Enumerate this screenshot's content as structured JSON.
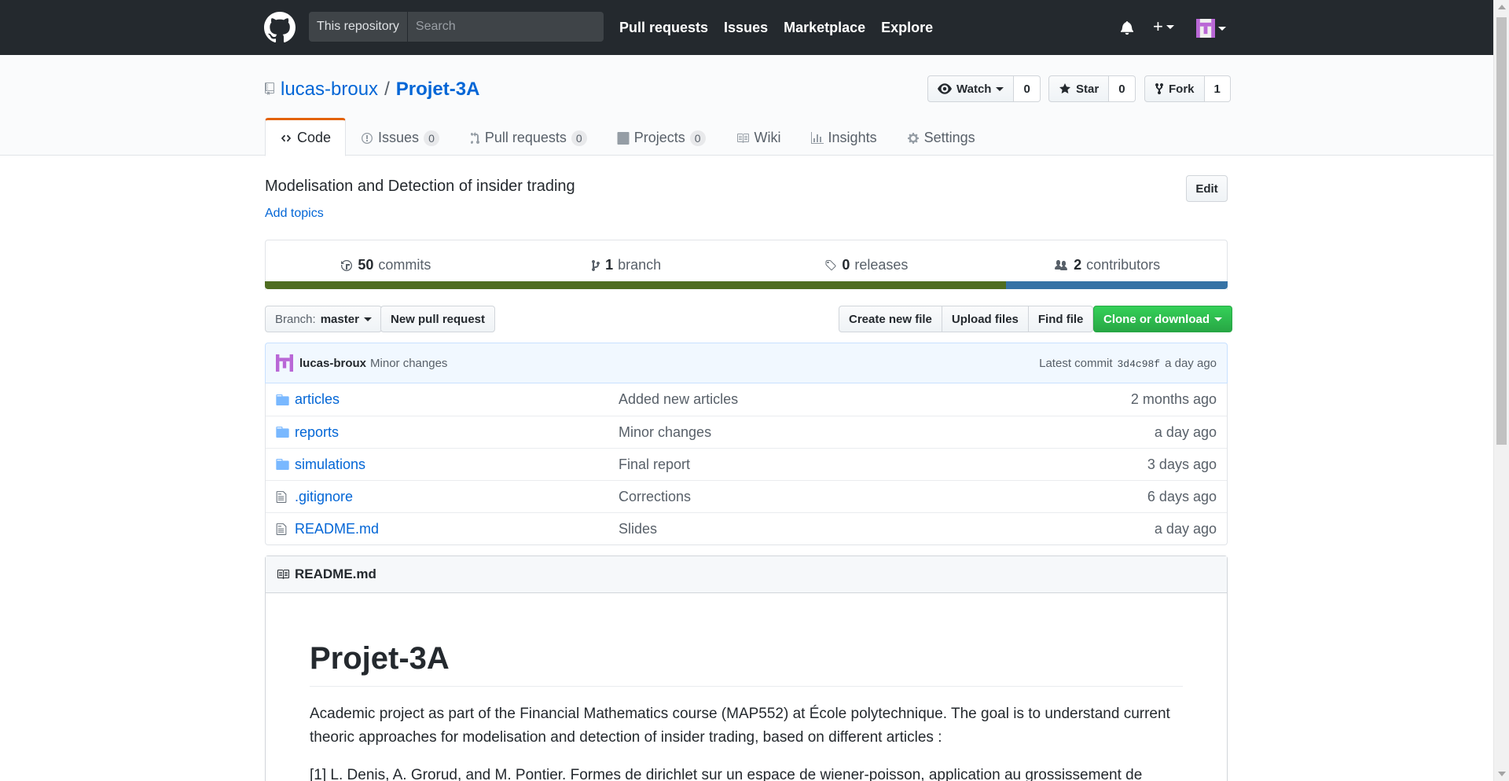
{
  "header": {
    "scope_label": "This repository",
    "search_placeholder": "Search",
    "nav": [
      "Pull requests",
      "Issues",
      "Marketplace",
      "Explore"
    ]
  },
  "repo": {
    "owner": "lucas-broux",
    "separator": "/",
    "name": "Projet-3A",
    "watch_label": "Watch",
    "watch_count": "0",
    "star_label": "Star",
    "star_count": "0",
    "fork_label": "Fork",
    "fork_count": "1"
  },
  "tabs": [
    {
      "label": "Code",
      "counter": ""
    },
    {
      "label": "Issues",
      "counter": "0"
    },
    {
      "label": "Pull requests",
      "counter": "0"
    },
    {
      "label": "Projects",
      "counter": "0"
    },
    {
      "label": "Wiki",
      "counter": ""
    },
    {
      "label": "Insights",
      "counter": ""
    },
    {
      "label": "Settings",
      "counter": ""
    }
  ],
  "description": "Modelisation and Detection of insider trading",
  "add_topics": "Add topics",
  "edit_label": "Edit",
  "summary": {
    "commits_num": "50",
    "commits_label": "commits",
    "branch_num": "1",
    "branch_label": "branch",
    "releases_num": "0",
    "releases_label": "releases",
    "contributors_num": "2",
    "contributors_label": "contributors"
  },
  "colors": {
    "lang_bar_1": "#4f6d21",
    "lang_bar_2": "#3572a5",
    "header_bg": "#24292e",
    "accent_orange": "#e36209",
    "clone_green": "#28a745"
  },
  "toolbar": {
    "branch_prefix": "Branch:",
    "branch_name": "master",
    "new_pull_request": "New pull request",
    "create_new_file": "Create new file",
    "upload_files": "Upload files",
    "find_file": "Find file",
    "clone_or_download": "Clone or download"
  },
  "commit": {
    "author": "lucas-broux",
    "message": "Minor changes",
    "latest_label": "Latest commit",
    "sha": "3d4c98f",
    "age": "a day ago"
  },
  "files": [
    {
      "name": "articles",
      "type": "folder-icon",
      "message": "Added new articles",
      "age": "2 months ago"
    },
    {
      "name": "reports",
      "type": "folder-icon",
      "message": "Minor changes",
      "age": "a day ago"
    },
    {
      "name": "simulations",
      "type": "folder-icon",
      "message": "Final report",
      "age": "3 days ago"
    },
    {
      "name": ".gitignore",
      "type": "file-icon",
      "message": "Corrections",
      "age": "6 days ago"
    },
    {
      "name": "README.md",
      "type": "file-icon",
      "message": "Slides",
      "age": "a day ago"
    }
  ],
  "readme": {
    "filename": "README.md",
    "title": "Projet-3A",
    "paragraph": "Academic project as part of the Financial Mathematics course (MAP552) at École polytechnique. The goal is to understand current theoric approaches for modelisation and detection of insider trading, based on different articles :",
    "reference": "[1] L. Denis, A. Grorud, and M. Pontier. Formes de dirichlet sur un espace de wiener-poisson, application au grossissement de"
  }
}
